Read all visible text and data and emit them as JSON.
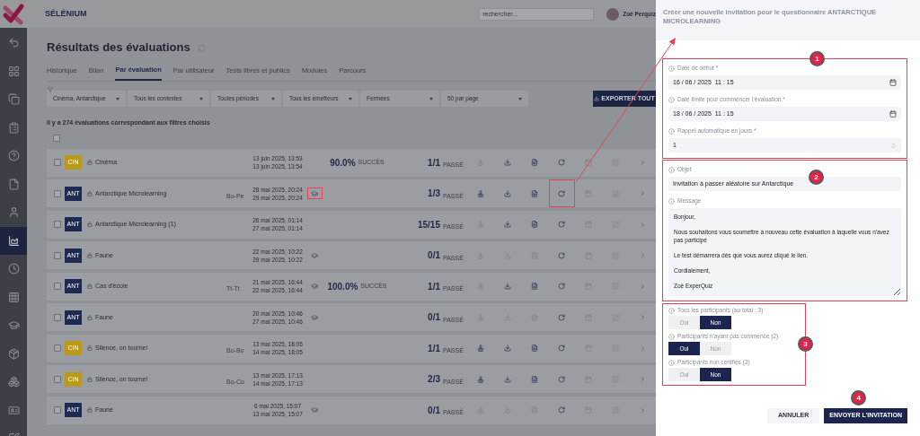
{
  "app": {
    "name": "SÉLÉNIUM",
    "search": {
      "placeholder": "rechercher..."
    },
    "user": {
      "name": "Zoé Perquiz"
    }
  },
  "sidebar": {
    "items": [
      {
        "kind": "undo",
        "selected": false
      },
      {
        "kind": "dashboard",
        "selected": false
      },
      {
        "kind": "copy",
        "selected": false
      },
      {
        "kind": "list",
        "selected": false
      },
      {
        "kind": "help",
        "selected": false
      },
      {
        "kind": "document",
        "selected": false
      },
      {
        "kind": "user",
        "selected": false
      },
      {
        "kind": "chart",
        "selected": true
      },
      {
        "kind": "clock",
        "selected": false
      },
      {
        "kind": "grid",
        "selected": false
      },
      {
        "kind": "graduation",
        "selected": false
      },
      {
        "kind": "box",
        "selected": false
      },
      {
        "kind": "boxes",
        "selected": false
      },
      {
        "kind": "idcard",
        "selected": false
      },
      {
        "kind": "edit",
        "selected": false
      }
    ]
  },
  "page": {
    "title": "Résultats des évaluations",
    "tabs": [
      {
        "label": "Historique",
        "selected": false
      },
      {
        "label": "Bilan",
        "selected": false
      },
      {
        "label": "Par évaluation",
        "selected": true
      },
      {
        "label": "Par utilisateur",
        "selected": false
      },
      {
        "label": "Tests libres et publics",
        "selected": false
      },
      {
        "label": "Modules",
        "selected": false
      },
      {
        "label": "Parcours",
        "selected": false
      }
    ],
    "filters": [
      "Cinéma, Antarctique",
      "Tous les contextes",
      "Toutes périodes",
      "Tous les émetteurs",
      "Fermées",
      "50 par page"
    ],
    "export_button": "EXPORTER TOUT",
    "count_text": "Il y a 274 évaluations correspondant aux filtres choisis"
  },
  "table": {
    "select_all_checked": false,
    "rows": [
      {
        "checked": false,
        "badge": "CIN",
        "color": "#b99a1a",
        "name": "Cinéma",
        "start": "13 juin 2025, 13:53",
        "end": "13 juin 2025, 13:54",
        "cap": false,
        "score": "90.0%",
        "result": "SUCCÈS",
        "count": "1/1",
        "status": "PASSÉ",
        "stamp_enabled": false,
        "download_enabled": true,
        "report_enabled": true,
        "refresh_highlighted": false
      },
      {
        "checked": false,
        "badge": "ANT",
        "color": "#1f2a50",
        "name": "Antarctique Microlearning",
        "code": "Bo-Pe",
        "start": "28 mai 2025, 20:24",
        "end": "29 mai 2025, 20:24",
        "cap": true,
        "count": "1/3",
        "status": "PASSÉ",
        "stamp_enabled": true,
        "download_enabled": true,
        "report_enabled": true,
        "cap_highlighted": true,
        "refresh_highlighted": true
      },
      {
        "checked": false,
        "badge": "ANT",
        "color": "#1f2a50",
        "name": "Antarctique Microlearning (1)",
        "start": "26 mai 2025, 01:14",
        "end": "27 mai 2025, 01:14",
        "cap": false,
        "count": "15/15",
        "status": "PASSÉ",
        "stamp_enabled": false,
        "download_enabled": true,
        "report_enabled": true,
        "refresh_highlighted": false
      },
      {
        "checked": false,
        "badge": "ANT",
        "color": "#1f2a50",
        "name": "Faune",
        "start": "22 mai 2025, 10:22",
        "end": "29 mai 2025, 10:22",
        "cap": true,
        "count": "0/1",
        "status": "PASSÉ",
        "stamp_enabled": false,
        "download_enabled": false,
        "report_enabled": false,
        "cap_highlighted": false,
        "refresh_highlighted": false
      },
      {
        "checked": false,
        "badge": "ANT",
        "color": "#1f2a50",
        "name": "Cas d'école",
        "code": "Tt-Tt",
        "start": "21 mai 2025, 16:44",
        "end": "22 mai 2025, 16:44",
        "cap": true,
        "score": "100.0%",
        "result": "SUCCÈS",
        "count": "1/1",
        "status": "PASSÉ",
        "stamp_enabled": false,
        "download_enabled": true,
        "report_enabled": true,
        "cap_highlighted": false,
        "refresh_highlighted": false
      },
      {
        "checked": false,
        "badge": "ANT",
        "color": "#1f2a50",
        "name": "Faune",
        "start": "20 mai 2025, 10:46",
        "end": "27 mai 2025, 10:46",
        "cap": true,
        "count": "0/1",
        "status": "PASSÉ",
        "stamp_enabled": false,
        "download_enabled": false,
        "report_enabled": false,
        "cap_highlighted": false,
        "refresh_highlighted": false
      },
      {
        "checked": false,
        "badge": "CIN",
        "color": "#b99a1a",
        "name": "Silence, on tourne!",
        "code": "Bo-Bo",
        "start": "13 mai 2025, 18:05",
        "end": "14 mai 2025, 18:05",
        "cap": false,
        "count": "1/1",
        "status": "PASSÉ",
        "stamp_enabled": true,
        "download_enabled": true,
        "report_enabled": true,
        "refresh_highlighted": false
      },
      {
        "checked": false,
        "badge": "CIN",
        "color": "#b99a1a",
        "name": "Silence, on tourne!",
        "code": "Bo-Co",
        "start": "13 mai 2025, 17:13",
        "end": "14 mai 2025, 17:13",
        "cap": false,
        "count": "2/3",
        "status": "PASSÉ",
        "stamp_enabled": true,
        "download_enabled": true,
        "report_enabled": true,
        "refresh_highlighted": false
      },
      {
        "checked": false,
        "badge": "ANT",
        "color": "#1f2a50",
        "name": "Faune",
        "start": "6 mai 2025, 15:07",
        "end": "13 mai 2025, 15:07",
        "cap": true,
        "count": "0/1",
        "status": "PASSÉ",
        "stamp_enabled": false,
        "download_enabled": false,
        "report_enabled": false,
        "cap_highlighted": false,
        "refresh_highlighted": false
      }
    ]
  },
  "panel": {
    "title": "Créer une nouvelle invitation pour le questionnaire ANTARCTIQUE MICROLEARNING",
    "sections": [
      {
        "number": "1",
        "fields": [
          {
            "kind": "datetime",
            "label": "Date de début *",
            "value": "16 / 06 / 2025  11 : 15"
          },
          {
            "kind": "datetime",
            "label": "Date limite pour commencer l'évaluation *",
            "value": "18 / 06 / 2025  11 : 15"
          },
          {
            "kind": "number",
            "label": "Rappel automatique en jours *",
            "value": "1"
          }
        ]
      },
      {
        "number": "2",
        "fields": [
          {
            "kind": "text",
            "label": "Objet",
            "value": "Invitation à passer aléatoire sur Antarctique"
          },
          {
            "kind": "textarea",
            "label": "Message",
            "value": "Bonjour,\n\nNous souhaitons vous soumettre à nouveau cette évaluation à laquelle vous n'avez pas participé\n\nLe test démarrera dès que vous aurez cliqué le lien.\n\nCordialement,\n\nZoé ExperQuiz"
          }
        ]
      },
      {
        "number": "3",
        "fields": [
          {
            "kind": "toggle",
            "label": "Tous les participants (au total : 3)",
            "options": [
              {
                "label": "Oui",
                "selected": false
              },
              {
                "label": "Non",
                "selected": true
              }
            ]
          },
          {
            "kind": "toggle",
            "label": "Participants n'ayant pas commencé (2)",
            "options": [
              {
                "label": "Oui",
                "selected": true
              },
              {
                "label": "Non",
                "selected": false
              }
            ]
          },
          {
            "kind": "toggle",
            "label": "Participants non certifiés (3)",
            "options": [
              {
                "label": "Oui",
                "selected": false
              },
              {
                "label": "Non",
                "selected": true
              }
            ]
          }
        ]
      }
    ],
    "buttons": [
      {
        "kind": "secondary",
        "label": "ANNULER"
      },
      {
        "kind": "primary",
        "label": "ENVOYER L'INVITATION",
        "number": "4"
      }
    ]
  }
}
